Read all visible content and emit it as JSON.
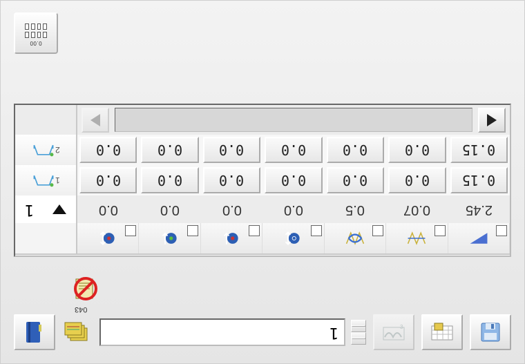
{
  "top_button": {
    "label": "0.00"
  },
  "table": {
    "scroll": {
      "left_enabled": false,
      "right_enabled": true
    },
    "rows": [
      {
        "id": 2,
        "values": [
          "0.0",
          "0.0",
          "0.0",
          "0.0",
          "0.0",
          "0.0",
          "0.15"
        ]
      },
      {
        "id": 1,
        "values": [
          "0.0",
          "0.0",
          "0.0",
          "0.0",
          "0.0",
          "0.0",
          "0.15"
        ]
      }
    ],
    "nav": {
      "cursor": "1",
      "values": [
        "0.0",
        "0.0",
        "0.0",
        "0.0",
        "0.5",
        "0.07",
        "2.45"
      ]
    },
    "params": [
      {
        "name": "param-a",
        "icon": "gear-arrow-red"
      },
      {
        "name": "param-b",
        "icon": "gear-arrow-green"
      },
      {
        "name": "param-c",
        "icon": "gear-arrow-green"
      },
      {
        "name": "param-d",
        "icon": "gear-arrow-blue"
      },
      {
        "name": "param-e",
        "icon": "wave-swap"
      },
      {
        "name": "param-f",
        "icon": "wave"
      },
      {
        "name": "param-g",
        "icon": "wedge"
      }
    ]
  },
  "status_icon": "program-disabled",
  "bottom": {
    "pattern_index": "043",
    "name_field": "1"
  }
}
